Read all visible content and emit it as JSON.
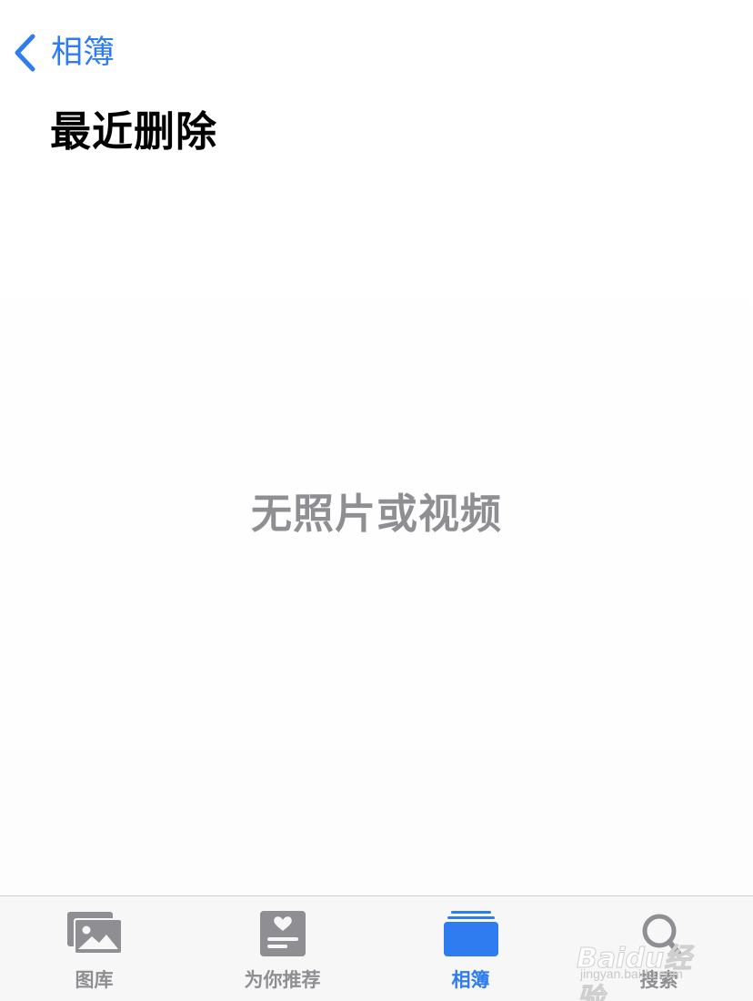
{
  "nav": {
    "back_label": "相簿"
  },
  "page": {
    "title": "最近删除",
    "empty_message": "无照片或视频"
  },
  "tab_bar": {
    "tabs": [
      {
        "label": "图库",
        "icon": "photo-library-icon",
        "active": false
      },
      {
        "label": "为你推荐",
        "icon": "for-you-icon",
        "active": false
      },
      {
        "label": "相簿",
        "icon": "albums-icon",
        "active": true
      },
      {
        "label": "搜索",
        "icon": "search-icon",
        "active": false
      }
    ]
  },
  "watermark": {
    "text": "Baidu经验",
    "url": "jingyan.baidu.com"
  },
  "colors": {
    "accent": "#2f7bf0",
    "inactive": "#8e8e93",
    "tab_bar_bg": "#f7f7f7"
  }
}
